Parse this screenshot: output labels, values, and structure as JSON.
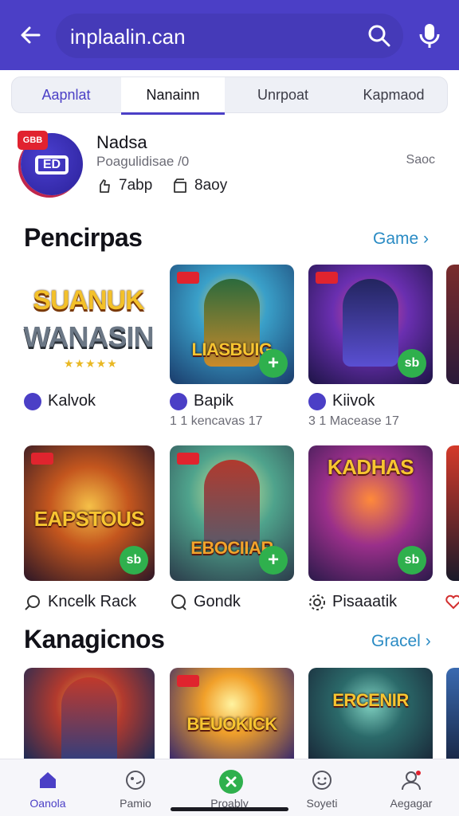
{
  "colors": {
    "accent": "#4b3fc6",
    "link": "#2a8bc4",
    "install": "#2fb04d",
    "badge": "#e1222f"
  },
  "header": {
    "search_value": "inplaalin.can",
    "back_icon": "arrow-left-icon",
    "search_icon": "search-icon",
    "mic_icon": "mic-icon"
  },
  "tabs": [
    {
      "label": "Aapnlat"
    },
    {
      "label": "Nanainn",
      "selected": true
    },
    {
      "label": "Unrpoat"
    },
    {
      "label": "Kapmaod"
    }
  ],
  "app": {
    "badge": "GBB",
    "logo_text": "ED",
    "name": "Nadsa",
    "subtitle": "Poagulidisae /0",
    "size": "Saoc",
    "stat1": "7abp",
    "stat2": "8aoy"
  },
  "section1": {
    "title": "Pencirpas",
    "link": "Game"
  },
  "section2": {
    "title": "Kanagicnos",
    "link": "Gracel"
  },
  "row1": {
    "logo_game": {
      "line1": "SUANUK",
      "line2": "WANASIN",
      "stars": "★★★★★"
    },
    "games": [
      {
        "title": "LIASBUIG"
      },
      {
        "title": ""
      }
    ],
    "meta": [
      {
        "name": "Kalvok",
        "sub": ""
      },
      {
        "name": "Bapik",
        "sub": "1 1 kencavas 17"
      },
      {
        "name": "Kiivok",
        "sub": "3 1 Macease 17"
      }
    ]
  },
  "row2": {
    "games": [
      {
        "title": "EAPSTOUS"
      },
      {
        "title": "EBOCIIAR"
      },
      {
        "title": "KADHAS"
      }
    ],
    "meta": [
      {
        "name": "Kncelk Rack"
      },
      {
        "name": "Gondk"
      },
      {
        "name": "Pisaaatik"
      }
    ]
  },
  "row3": {
    "games": [
      {
        "title": ""
      },
      {
        "title": "BEUOKICK"
      },
      {
        "title": "ERCENIR"
      }
    ]
  },
  "nav": [
    {
      "label": "Oanola",
      "icon": "home-icon",
      "active": true
    },
    {
      "label": "Pamio",
      "icon": "games-icon"
    },
    {
      "label": "Proably",
      "icon": "play-icon"
    },
    {
      "label": "Soyeti",
      "icon": "smile-icon"
    },
    {
      "label": "Aegagar",
      "icon": "profile-icon"
    }
  ]
}
